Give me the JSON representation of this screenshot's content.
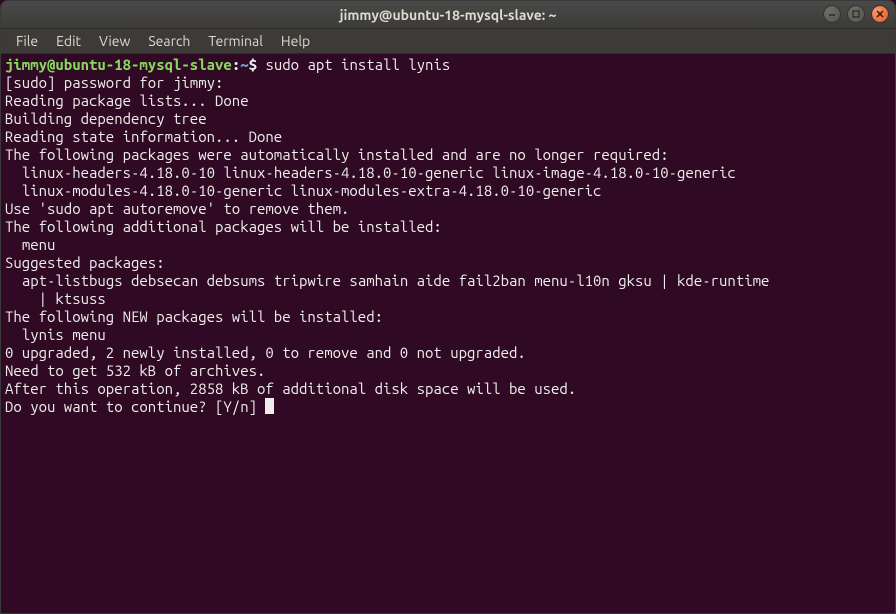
{
  "window": {
    "title": "jimmy@ubuntu-18-mysql-slave: ~"
  },
  "menubar": {
    "items": [
      "File",
      "Edit",
      "View",
      "Search",
      "Terminal",
      "Help"
    ]
  },
  "prompt": {
    "user_host": "jimmy@ubuntu-18-mysql-slave",
    "colon": ":",
    "path": "~",
    "dollar": "$ ",
    "command": "sudo apt install lynis"
  },
  "output": [
    "[sudo] password for jimmy:",
    "Reading package lists... Done",
    "Building dependency tree",
    "Reading state information... Done",
    "The following packages were automatically installed and are no longer required:",
    "  linux-headers-4.18.0-10 linux-headers-4.18.0-10-generic linux-image-4.18.0-10-generic",
    "  linux-modules-4.18.0-10-generic linux-modules-extra-4.18.0-10-generic",
    "Use 'sudo apt autoremove' to remove them.",
    "The following additional packages will be installed:",
    "  menu",
    "Suggested packages:",
    "  apt-listbugs debsecan debsums tripwire samhain aide fail2ban menu-l10n gksu | kde-runtime",
    "    | ktsuss",
    "The following NEW packages will be installed:",
    "  lynis menu",
    "0 upgraded, 2 newly installed, 0 to remove and 0 not upgraded.",
    "Need to get 532 kB of archives.",
    "After this operation, 2858 kB of additional disk space will be used.",
    "Do you want to continue? [Y/n] "
  ]
}
